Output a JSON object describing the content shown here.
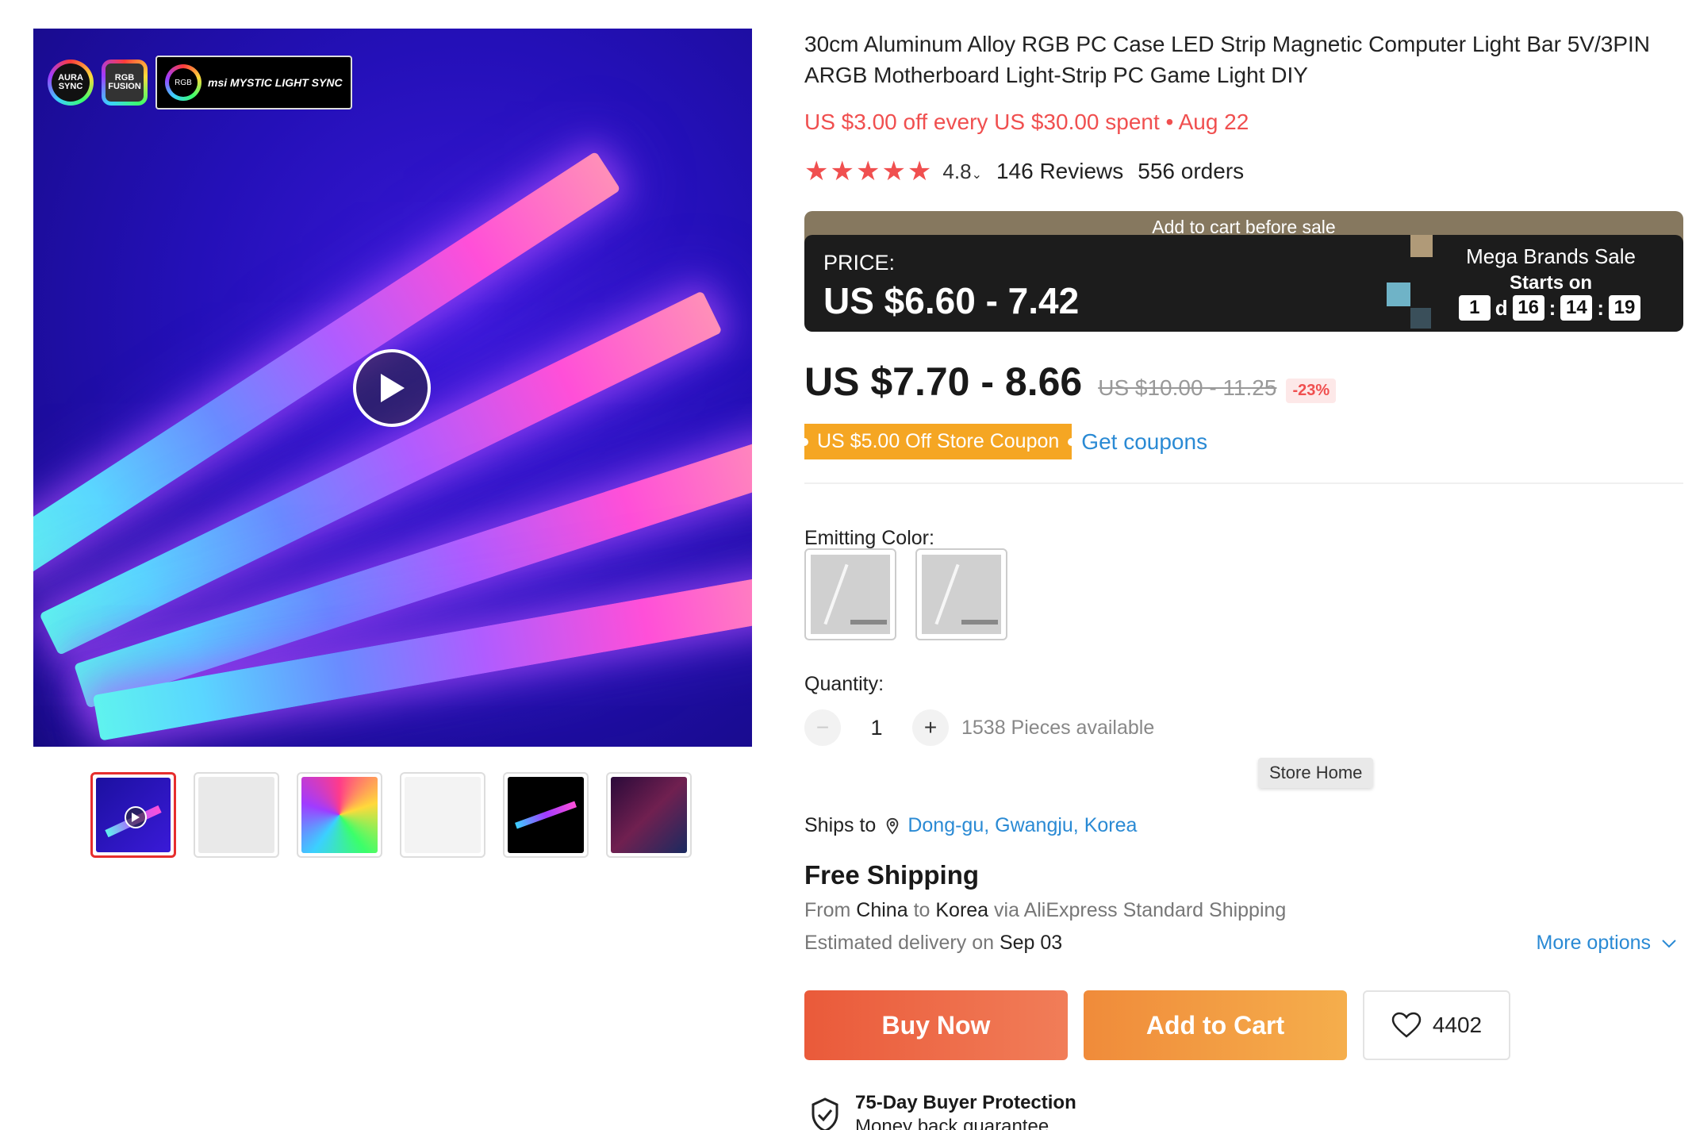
{
  "gallery": {
    "brand_logos": {
      "aura": "AURA SYNC",
      "fusion": "RGB FUSION",
      "msi_ring": "RGB",
      "msi": "msi MYSTIC LIGHT SYNC"
    },
    "play_icon": "play-icon",
    "thumbnails": [
      "thumb-1-video",
      "thumb-2",
      "thumb-3",
      "thumb-4",
      "thumb-5",
      "thumb-6"
    ]
  },
  "product": {
    "title": "30cm Aluminum Alloy RGB PC Case LED Strip Magnetic Computer Light Bar 5V/3PIN ARGB Motherboard Light-Strip PC Game Light DIY",
    "promo": "US $3.00 off every US $30.00 spent • Aug 22",
    "rating": "4.8",
    "rating_caret": "⌄",
    "reviews": "146 Reviews",
    "orders": "556 orders"
  },
  "sale": {
    "banner": "Add to cart before sale",
    "price_label": "PRICE:",
    "price": "US $6.60 - 7.42",
    "event": "Mega Brands Sale",
    "starts_on": "Starts on",
    "countdown": {
      "days": "1",
      "d": "d",
      "hours": "16",
      "minutes": "14",
      "seconds": "19",
      "sep": ":"
    }
  },
  "pricing": {
    "current": "US $7.70 - 8.66",
    "original": "US $10.00 - 11.25",
    "discount": "-23%"
  },
  "coupon": {
    "label": "US $5.00 Off Store Coupon",
    "link": "Get coupons"
  },
  "options": {
    "color_label": "Emitting Color:",
    "quantity_label": "Quantity:",
    "quantity": "1",
    "minus": "−",
    "plus": "+",
    "available": "1538 Pieces available"
  },
  "tooltip": "Store Home",
  "shipping": {
    "ships_to_label": "Ships to",
    "location": "Dong-gu, Gwangju, Korea",
    "free": "Free Shipping",
    "from_label": "From",
    "from": "China",
    "to_label": "to",
    "to": "Korea",
    "via": "via AliExpress Standard Shipping",
    "est_label": "Estimated delivery on",
    "est_date": "Sep 03",
    "more_options": "More options"
  },
  "actions": {
    "buy_now": "Buy Now",
    "add_to_cart": "Add to Cart",
    "wishlist_count": "4402"
  },
  "protection": {
    "title": "75-Day Buyer Protection",
    "subtitle": "Money back guarantee"
  },
  "colors": {
    "accent_red": "#f04f4f",
    "link_blue": "#2a8ad4",
    "coupon_orange": "#f5a623",
    "buy_now": "#ea5a3a",
    "add_to_cart": "#f08b3a"
  }
}
